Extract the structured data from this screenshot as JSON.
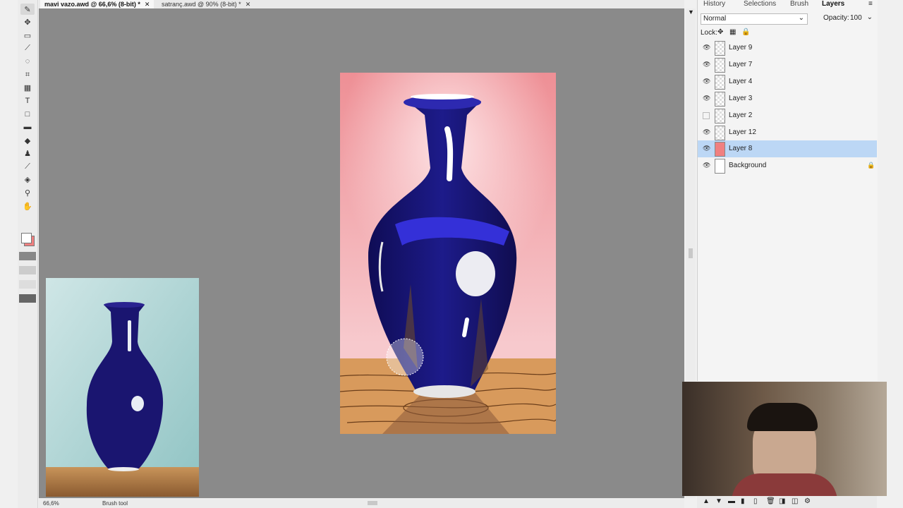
{
  "documents": [
    {
      "title": "mavi vazo.awd @ 66,6% (8-bit) *",
      "active": true
    },
    {
      "title": "satranç.awd @ 90% (8-bit) *",
      "active": false
    }
  ],
  "tools": [
    {
      "name": "brush-tool-icon",
      "glyph": "✎",
      "active": true
    },
    {
      "name": "move-tool-icon",
      "glyph": "✥"
    },
    {
      "name": "marquee-tool-icon",
      "glyph": "▭"
    },
    {
      "name": "magic-wand-icon",
      "glyph": "⟋"
    },
    {
      "name": "lasso-tool-icon",
      "glyph": "◌"
    },
    {
      "name": "crop-tool-icon",
      "glyph": "⌗"
    },
    {
      "name": "grid-tool-icon",
      "glyph": "▦"
    },
    {
      "name": "text-tool-icon",
      "glyph": "T"
    },
    {
      "name": "shape-tool-icon",
      "glyph": "□"
    },
    {
      "name": "gradient-tool-icon",
      "glyph": "▬"
    },
    {
      "name": "eraser-tool-icon",
      "glyph": "◆"
    },
    {
      "name": "stamp-tool-icon",
      "glyph": "♟"
    },
    {
      "name": "eyedropper-tool-icon",
      "glyph": "⟋"
    },
    {
      "name": "fill-tool-icon",
      "glyph": "◈"
    },
    {
      "name": "zoom-tool-icon",
      "glyph": "⚲"
    },
    {
      "name": "hand-tool-icon",
      "glyph": "✋"
    }
  ],
  "colors": {
    "foreground": "#f08080",
    "background": "#ffffff",
    "canvas_bg": "#8a8a8a",
    "selection": "#bcd7f5"
  },
  "panel": {
    "tabs": [
      "History",
      "Selections",
      "Brush",
      "Layers"
    ],
    "active_tab": "Layers",
    "blend_mode": "Normal",
    "opacity_label": "Opacity:",
    "opacity_value": "100",
    "lock_label": "Lock:"
  },
  "layers": [
    {
      "name": "Layer 9",
      "visible": true
    },
    {
      "name": "Layer 7",
      "visible": true
    },
    {
      "name": "Layer 4",
      "visible": true
    },
    {
      "name": "Layer 3",
      "visible": true
    },
    {
      "name": "Layer 2",
      "visible": false
    },
    {
      "name": "Layer 12",
      "visible": true
    },
    {
      "name": "Layer 8",
      "visible": true,
      "selected": true
    },
    {
      "name": "Background",
      "visible": true,
      "locked": true
    }
  ],
  "status": {
    "zoom": "66,6%",
    "tool": "Brush tool"
  }
}
